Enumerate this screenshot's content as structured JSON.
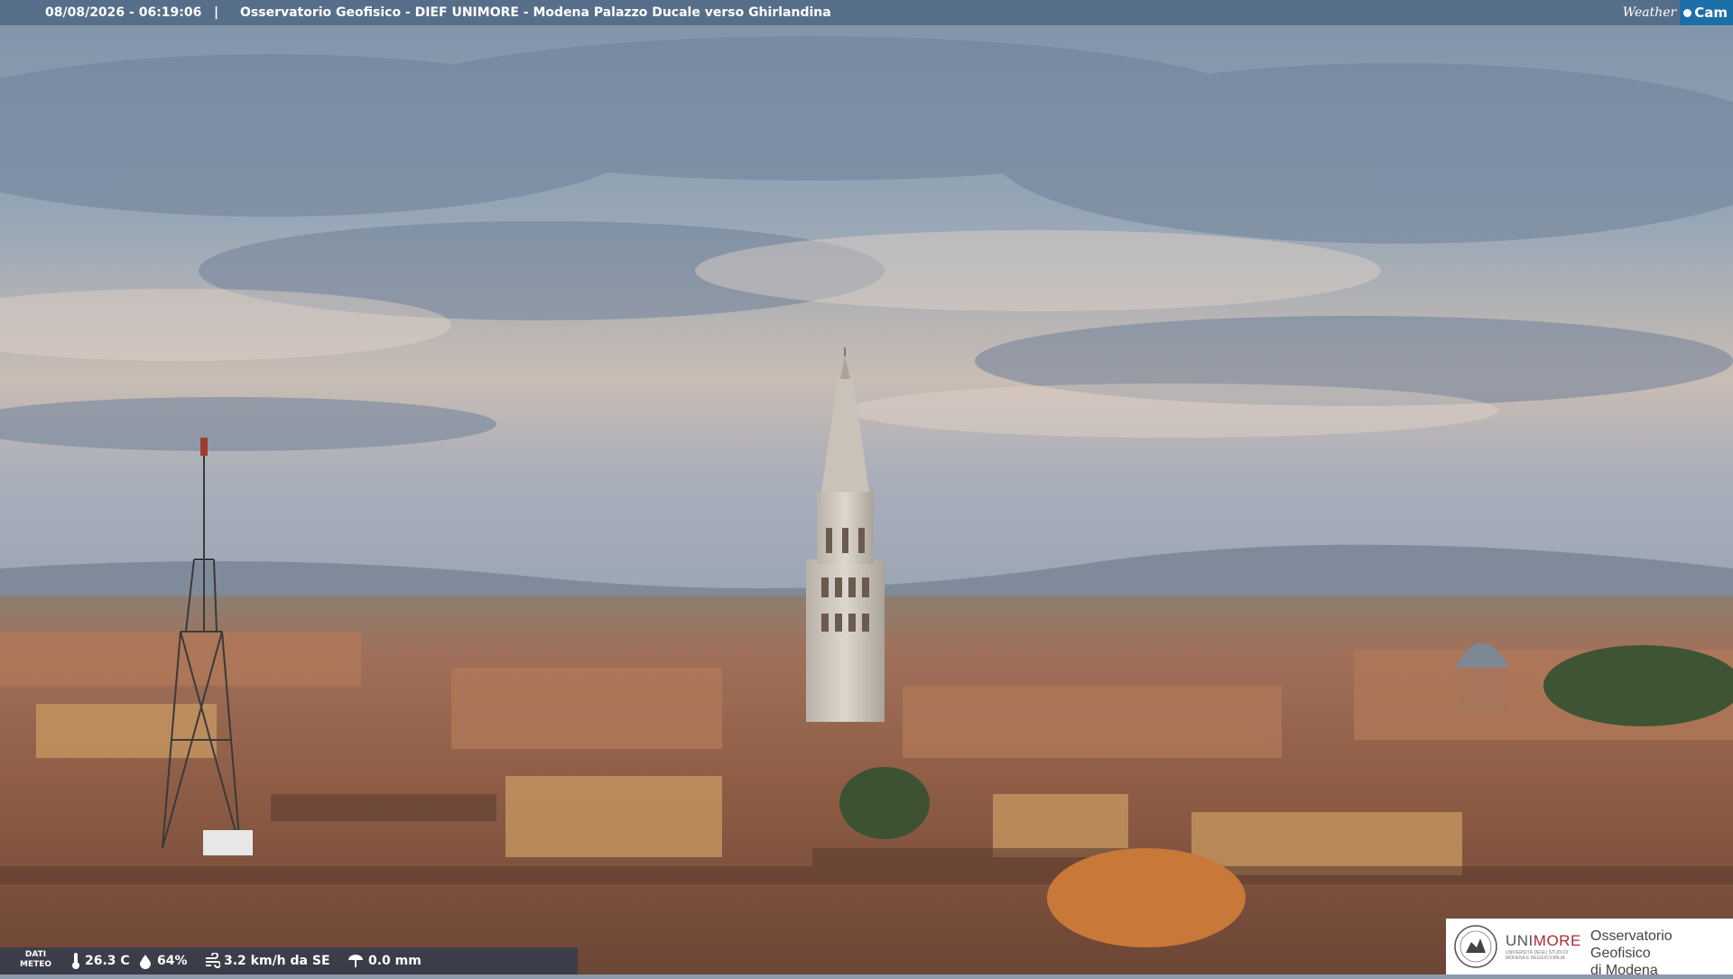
{
  "overlay": {
    "datetime": "08/08/2026 - 06:19:06",
    "separator": "|",
    "title": "Osservatorio Geofisico - DIEF UNIMORE - Modena Palazzo Ducale verso Ghirlandina"
  },
  "logo": {
    "weather": "Weather",
    "cam": "Cam"
  },
  "weather_stats": {
    "label_line1": "DATI",
    "label_line2": "METEO",
    "temperature": "26.3 C",
    "humidity": "64%",
    "wind": "3.2 km/h da SE",
    "rain": "0.0 mm",
    "icons": [
      "thermometer-icon",
      "humidity-drop-icon",
      "wind-icon",
      "rain-icon"
    ]
  },
  "branding": {
    "university": "UNIMORE",
    "university_highlight": "MORE",
    "university_prefix": "UNI",
    "university_sub1": "UNIVERSITÀ DEGLI STUDI DI",
    "university_sub2": "MODENA E REGGIO EMILIA",
    "observatory_line1": "Osservatorio Geofisico",
    "observatory_line2": "di Modena"
  },
  "colors": {
    "overlay_bar": "#465f7d",
    "cam_badge": "#1d6fa8",
    "unimore_red": "#b02a30"
  }
}
